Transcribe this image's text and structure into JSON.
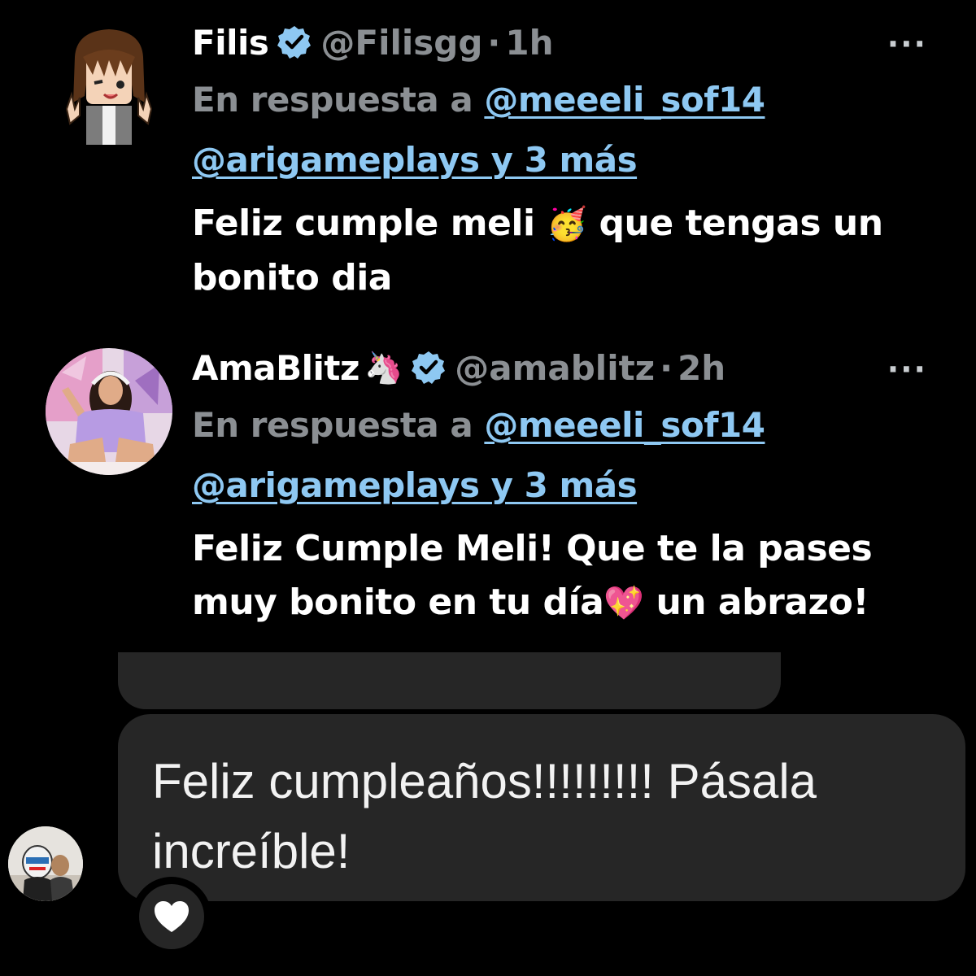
{
  "tweets": [
    {
      "name": "Filis",
      "name_emoji": "",
      "handle": "@Filisgg",
      "time": "1h",
      "more": "···",
      "reply_prefix": "En respuesta a ",
      "mention_1": "@meeeli_sof14",
      "mention_2": "@arigameplays y 3 más",
      "text_a": "Feliz cumple meli ",
      "text_emoji": "🥳",
      "text_b": " que tengas un bonito dia",
      "avatar_icon": "pixel-anime-avatar-icon"
    },
    {
      "name": "AmaBlitz",
      "name_emoji": "🦄",
      "handle": "@amablitz",
      "time": "2h",
      "more": "···",
      "reply_prefix": "En respuesta a ",
      "mention_1": "@meeeli_sof14",
      "mention_2": "@arigameplays y 3 más",
      "text_a": "Feliz Cumple Meli! Que te la pases muy bonito en tu día",
      "text_emoji": "💖",
      "text_b": " un abrazo!",
      "avatar_icon": "profile-photo-icon"
    }
  ],
  "comment": {
    "text": "Feliz cumpleaños!!!!!!!!! Pásala increíble!",
    "like_icon": "heart-icon"
  },
  "colors": {
    "background": "#000000",
    "muted": "#8b8f93",
    "link": "#8ec8f2",
    "verified": "#8ec8f2",
    "bubble": "#262626"
  }
}
